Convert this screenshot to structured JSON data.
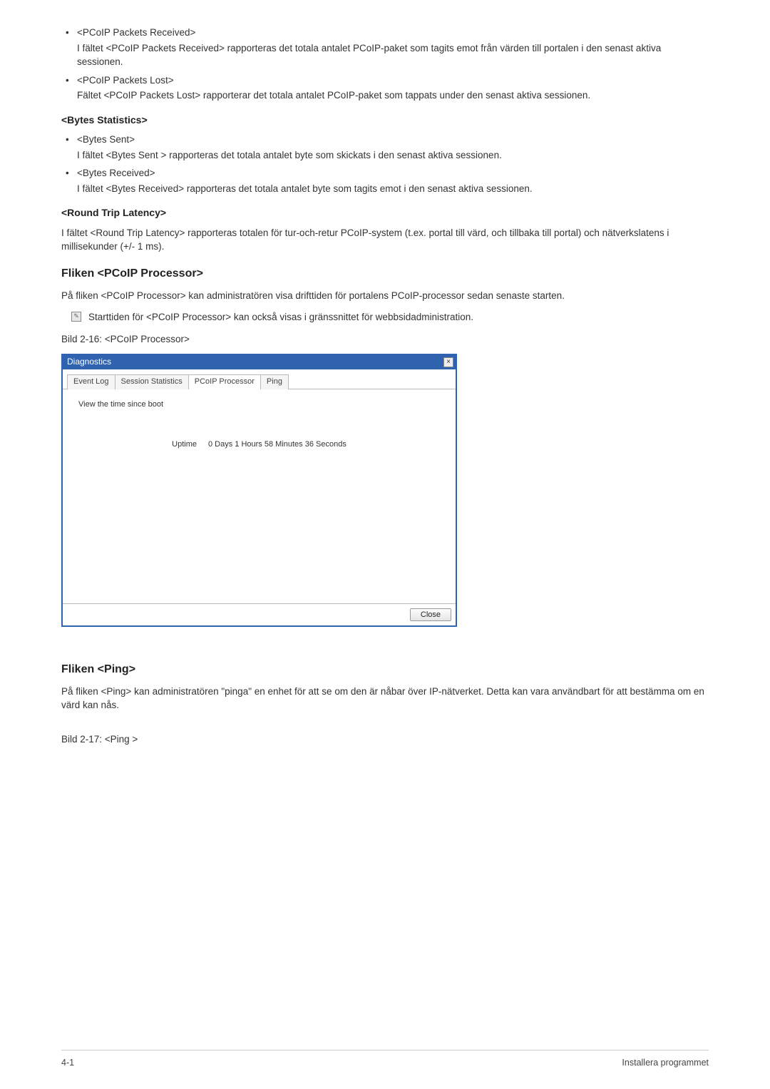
{
  "packets": {
    "received_title": "<PCoIP Packets Received>",
    "received_desc": "I fältet <PCoIP Packets Received> rapporteras det totala antalet PCoIP-paket som tagits emot från värden till portalen i den senast aktiva sessionen.",
    "lost_title": "<PCoIP Packets Lost>",
    "lost_desc": "Fältet <PCoIP Packets Lost> rapporterar det totala antalet PCoIP-paket som tappats under den senast aktiva sessionen."
  },
  "bytes": {
    "heading": "<Bytes Statistics>",
    "sent_title": "<Bytes Sent>",
    "sent_desc": "I fältet <Bytes Sent > rapporteras det totala antalet byte som skickats i den senast aktiva sessionen.",
    "received_title": "<Bytes Received>",
    "received_desc": "I fältet <Bytes Received> rapporteras det totala antalet byte som tagits emot i den senast aktiva sessionen."
  },
  "latency": {
    "heading": "<Round Trip Latency>",
    "desc": "I fältet <Round Trip Latency> rapporteras totalen för tur-och-retur PCoIP-system (t.ex. portal till värd, och tillbaka till portal) och nätverkslatens i millisekunder (+/- 1 ms)."
  },
  "processor": {
    "heading": "Fliken <PCoIP Processor>",
    "desc": "På fliken <PCoIP Processor> kan administratören visa drifttiden för portalens PCoIP-processor sedan senaste starten.",
    "note": "Starttiden för <PCoIP Processor> kan också visas i gränssnittet för webbsidadministration.",
    "caption": "Bild 2-16: <PCoIP Processor>"
  },
  "dialog": {
    "title": "Diagnostics",
    "tabs": {
      "event_log": "Event Log",
      "session_stats": "Session Statistics",
      "pcoip_processor": "PCoIP Processor",
      "ping": "Ping"
    },
    "body_text": "View the time since boot",
    "uptime_label": "Uptime",
    "uptime_value": "0 Days 1 Hours 58 Minutes 36 Seconds",
    "close_btn": "Close",
    "close_x": "×"
  },
  "ping": {
    "heading": "Fliken <Ping>",
    "desc": "På fliken <Ping> kan administratören \"pinga\" en enhet för att se om den är nåbar över IP-nätverket. Detta kan vara användbart för att bestämma om en värd kan nås.",
    "caption": "Bild 2-17: <Ping >"
  },
  "footer": {
    "left": "4-1",
    "right": "Installera programmet"
  }
}
